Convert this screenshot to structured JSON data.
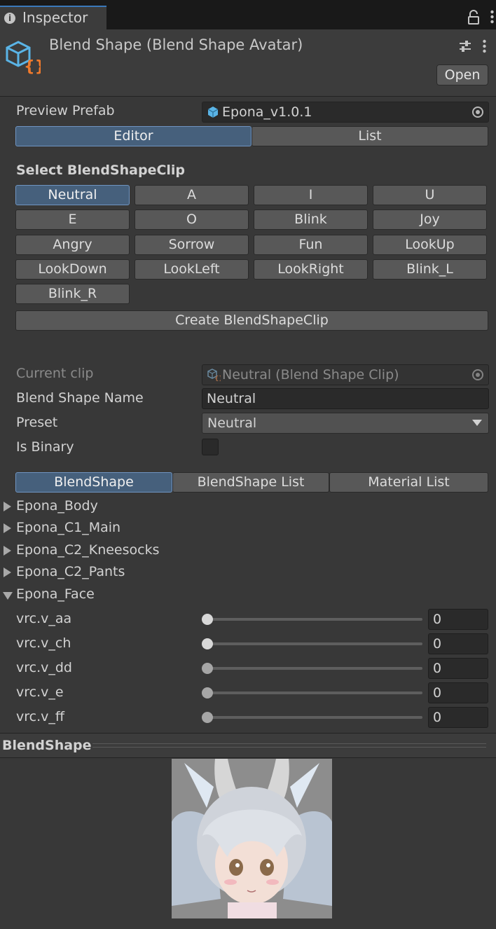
{
  "window": {
    "tab_title": "Inspector",
    "tab_icon": "info-icon"
  },
  "header": {
    "title": "Blend Shape (Blend Shape Avatar)",
    "open_label": "Open",
    "icon": "blendshape-asset-icon"
  },
  "preview_prefab": {
    "label": "Preview Prefab",
    "value": "Epona_v1.0.1",
    "icon": "prefab-cube-icon"
  },
  "mode_tabs": [
    {
      "label": "Editor",
      "active": true
    },
    {
      "label": "List",
      "active": false
    }
  ],
  "select_section": {
    "title": "Select BlendShapeClip"
  },
  "clips": [
    "Neutral",
    "A",
    "I",
    "U",
    "E",
    "O",
    "Blink",
    "Joy",
    "Angry",
    "Sorrow",
    "Fun",
    "LookUp",
    "LookDown",
    "LookLeft",
    "LookRight",
    "Blink_L",
    "Blink_R"
  ],
  "create_label": "Create BlendShapeClip",
  "current_clip": {
    "label": "Current clip",
    "value": "Neutral (Blend Shape Clip)"
  },
  "blend_shape_name": {
    "label": "Blend Shape Name",
    "value": "Neutral"
  },
  "preset": {
    "label": "Preset",
    "value": "Neutral"
  },
  "is_binary": {
    "label": "Is Binary",
    "checked": false
  },
  "sub_tabs": [
    {
      "label": "BlendShape",
      "active": true
    },
    {
      "label": "BlendShape List",
      "active": false
    },
    {
      "label": "Material List",
      "active": false
    }
  ],
  "meshes": [
    {
      "name": "Epona_Body",
      "expanded": false
    },
    {
      "name": "Epona_C1_Main",
      "expanded": false
    },
    {
      "name": "Epona_C2_Kneesocks",
      "expanded": false
    },
    {
      "name": "Epona_C2_Pants",
      "expanded": false
    },
    {
      "name": "Epona_Face",
      "expanded": true
    }
  ],
  "sliders": [
    {
      "name": "vrc.v_aa",
      "value": "0",
      "level": 0
    },
    {
      "name": "vrc.v_ch",
      "value": "0",
      "level": 0
    },
    {
      "name": "vrc.v_dd",
      "value": "0",
      "level": 0
    },
    {
      "name": "vrc.v_e",
      "value": "0",
      "level": 0
    },
    {
      "name": "vrc.v_ff",
      "value": "0",
      "level": 0
    }
  ],
  "preview_section": {
    "title": "BlendShape"
  },
  "colors": {
    "accent": "#46607c",
    "accent_border": "#6f94c1",
    "panel": "#383838",
    "asset_icon_blue": "#5ab4e6",
    "asset_icon_orange": "#f07a2c"
  }
}
